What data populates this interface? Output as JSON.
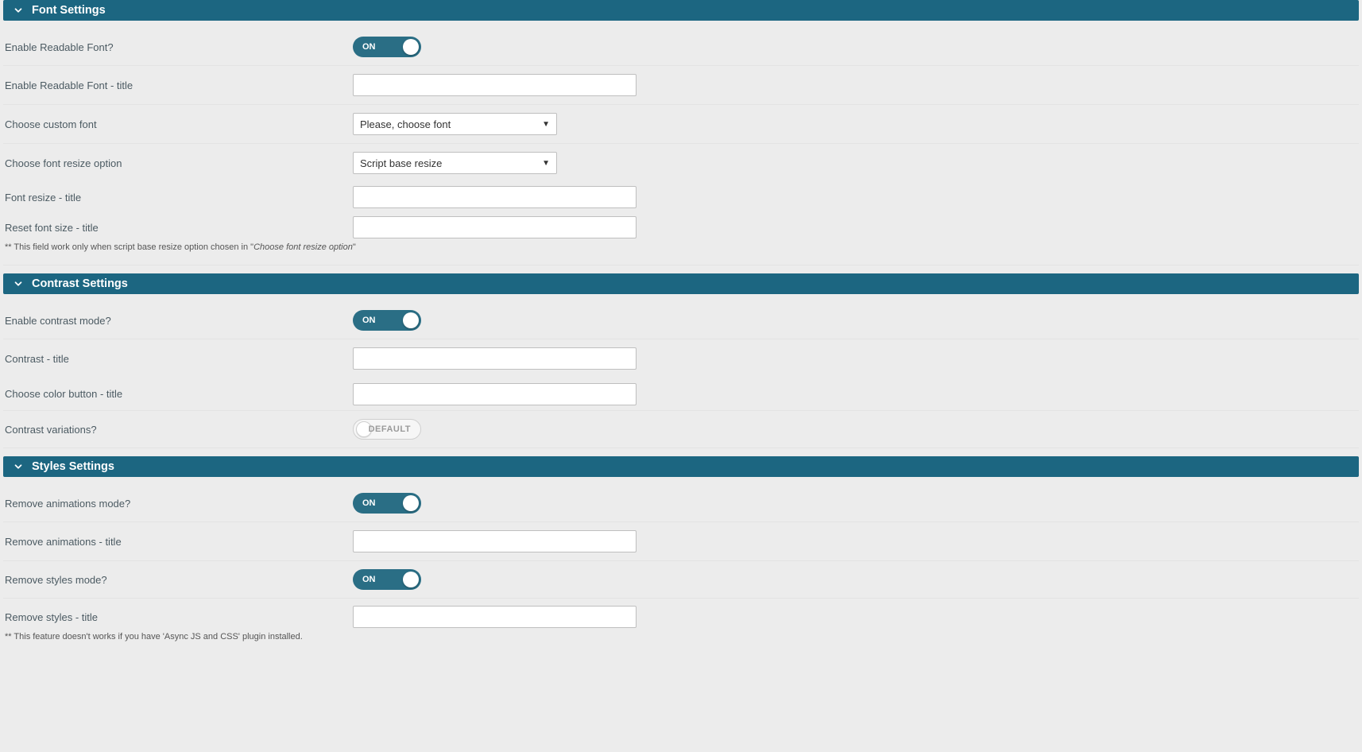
{
  "toggle": {
    "on_label": "ON",
    "default_label": "DEFAULT"
  },
  "font_section": {
    "title": "Font Settings",
    "enable_label": "Enable Readable Font?",
    "enable_value": "on",
    "title_label": "Enable Readable Font - title",
    "title_value": "",
    "custom_font_label": "Choose custom font",
    "custom_font_selected": "Please, choose font",
    "resize_option_label": "Choose font resize option",
    "resize_option_selected": "Script base resize",
    "font_resize_title_label": "Font resize - title",
    "font_resize_title_value": "",
    "reset_font_title_label": "Reset font size - title",
    "reset_font_title_value": "",
    "note_prefix": "** This field work only when script base resize option chosen in \"",
    "note_ital": "Choose font resize option",
    "note_suffix": "\""
  },
  "contrast_section": {
    "title": "Contrast Settings",
    "enable_label": "Enable contrast mode?",
    "enable_value": "on",
    "title_label": "Contrast - title",
    "title_value": "",
    "color_btn_label": "Choose color button - title",
    "color_btn_value": "",
    "variations_label": "Contrast variations?",
    "variations_value": "default"
  },
  "styles_section": {
    "title": "Styles Settings",
    "remove_anim_label": "Remove animations mode?",
    "remove_anim_value": "on",
    "remove_anim_title_label": "Remove animations - title",
    "remove_anim_title_value": "",
    "remove_styles_label": "Remove styles mode?",
    "remove_styles_value": "on",
    "remove_styles_title_label": "Remove styles - title",
    "remove_styles_title_value": "",
    "note": "** This feature doesn't works if you have 'Async JS and CSS' plugin installed."
  }
}
